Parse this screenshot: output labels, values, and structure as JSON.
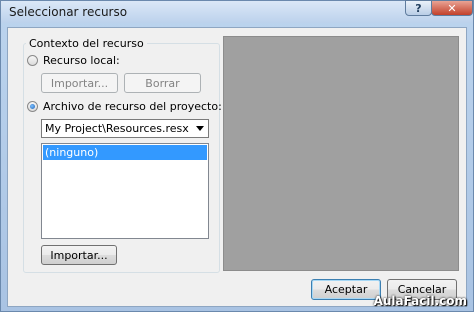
{
  "window": {
    "title": "Seleccionar recurso"
  },
  "titlebar": {
    "help_label": "?",
    "close_label": "✕"
  },
  "group": {
    "title": "Contexto del recurso",
    "local_radio_label": "Recurso local:",
    "project_radio_label": "Archivo de recurso del proyecto:",
    "selected": "project"
  },
  "local": {
    "import_label": "Importar...",
    "clear_label": "Borrar"
  },
  "project": {
    "select_value": "My Project\\Resources.resx",
    "list_items": [
      "(ninguno)"
    ],
    "import_label": "Importar..."
  },
  "footer": {
    "accept_label": "Aceptar",
    "cancel_label": "Cancelar"
  },
  "watermark": "AulaFacil.com",
  "colors": {
    "selection": "#3399ff",
    "preview": "#a0a0a0",
    "titlebar": "#bcd2ec"
  }
}
